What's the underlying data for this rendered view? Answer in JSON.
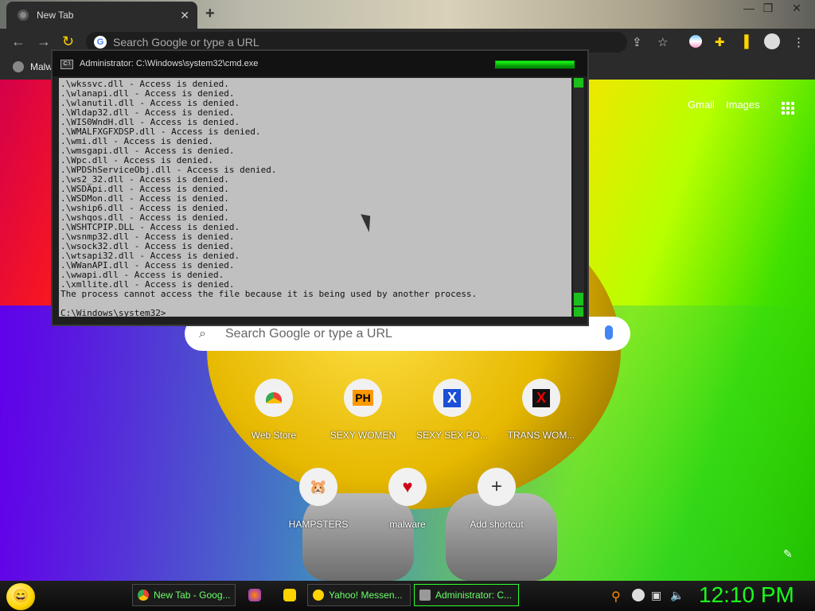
{
  "browser": {
    "tab_title": "New Tab",
    "omnibox_placeholder": "Search Google or type a URL",
    "bookmark_label": "Malw"
  },
  "newtab": {
    "gmail": "Gmail",
    "images": "Images",
    "search_placeholder": "Search Google or type a URL",
    "shortcuts": [
      {
        "label": "Web Store",
        "icon": "chrome-webstore-icon"
      },
      {
        "label": "SEXY WOMEN",
        "icon": "PH"
      },
      {
        "label": "SEXY SEX PO...",
        "icon": "X"
      },
      {
        "label": "TRANS WOM...",
        "icon": "X"
      },
      {
        "label": "HAMPSTERS",
        "icon": "hamster-icon"
      },
      {
        "label": "malware",
        "icon": "heart-icon"
      },
      {
        "label": "Add shortcut",
        "icon": "+"
      }
    ]
  },
  "cmd": {
    "title": "Administrator: C:\\Windows\\system32\\cmd.exe",
    "lines": [
      ".\\wkssvc.dll - Access is denied.",
      ".\\wlanapi.dll - Access is denied.",
      ".\\wlanutil.dll - Access is denied.",
      ".\\Wldap32.dll - Access is denied.",
      ".\\WIS0WndH.dll - Access is denied.",
      ".\\WMALFXGFXDSP.dll - Access is denied.",
      ".\\wmi.dll - Access is denied.",
      ".\\wmsgapi.dll - Access is denied.",
      ".\\Wpc.dll - Access is denied.",
      ".\\WPDShServiceObj.dll - Access is denied.",
      ".\\ws2_32.dll - Access is denied.",
      ".\\WSDApi.dll - Access is denied.",
      ".\\WSDMon.dll - Access is denied.",
      ".\\wship6.dll - Access is denied.",
      ".\\wshqos.dll - Access is denied.",
      ".\\WSHTCPIP.DLL - Access is denied.",
      ".\\wsnmp32.dll - Access is denied.",
      ".\\wsock32.dll - Access is denied.",
      ".\\wtsapi32.dll - Access is denied.",
      ".\\WWanAPI.dll - Access is denied.",
      ".\\wwapi.dll - Access is denied.",
      ".\\xmllite.dll - Access is denied.",
      "The process cannot access the file because it is being used by another process.",
      "",
      "C:\\Windows\\system32>_"
    ]
  },
  "taskbar": {
    "items": [
      {
        "label": "New Tab - Goog...",
        "color": "#e8e8e8"
      },
      {
        "label": "Yahoo! Messen...",
        "color": "#ffd400"
      },
      {
        "label": "Administrator: C...",
        "color": "#999999"
      }
    ],
    "clock": "12:10 PM"
  }
}
